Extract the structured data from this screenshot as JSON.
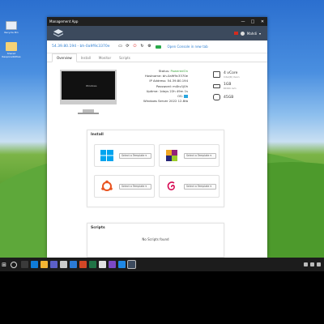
{
  "desktop": {
    "icons": [
      {
        "label": "Recycle Bin",
        "name": "recycle-bin-icon"
      },
      {
        "label": "Shared Responsibilities",
        "name": "shared-folder-icon"
      }
    ]
  },
  "window": {
    "title": "Management App",
    "controls": [
      "—",
      "□",
      "✕"
    ]
  },
  "header": {
    "user": "Mahdi"
  },
  "instance": {
    "name": "54.39.80.194 - bh-0a9f9c3370e",
    "external_link": "Open Console in new tab"
  },
  "tabs": [
    {
      "label": "Overview",
      "active": true
    },
    {
      "label": "Install",
      "active": false
    },
    {
      "label": "Monitor",
      "active": false
    },
    {
      "label": "Scripts",
      "active": false
    }
  ],
  "overview": {
    "status_label": "Status:",
    "status_value": "PoweredOn",
    "hostname": "Hostname: bh-0a9f9c3370e",
    "ip": "IP Address: 54.39.80.194",
    "password": "Password: m4kv1j0h",
    "uptime": "Uptime: 1days 22h 49m 1s",
    "os_label": "OS:",
    "os_name": "Windows Server 2022 12.8tb",
    "monitor_logo": "Windows"
  },
  "specs": [
    {
      "main": "4 vCore",
      "sub": "Intel(R) Xeon",
      "icon": "cpu-icon"
    },
    {
      "main": "1GB",
      "sub": "DDR4 ram",
      "icon": "ram-icon"
    },
    {
      "main": "45GB",
      "sub": "",
      "icon": "disk-icon"
    }
  ],
  "install": {
    "title": "Install",
    "template_placeholder": "Select a Template ▾",
    "os_options": [
      {
        "name": "windows",
        "color": "#00a4ef"
      },
      {
        "name": "centos",
        "color": "#932279"
      },
      {
        "name": "ubuntu",
        "color": "#e95420"
      },
      {
        "name": "debian",
        "color": "#d70a53"
      }
    ]
  },
  "scripts": {
    "title": "Scripts",
    "empty": "No Scripts found"
  }
}
